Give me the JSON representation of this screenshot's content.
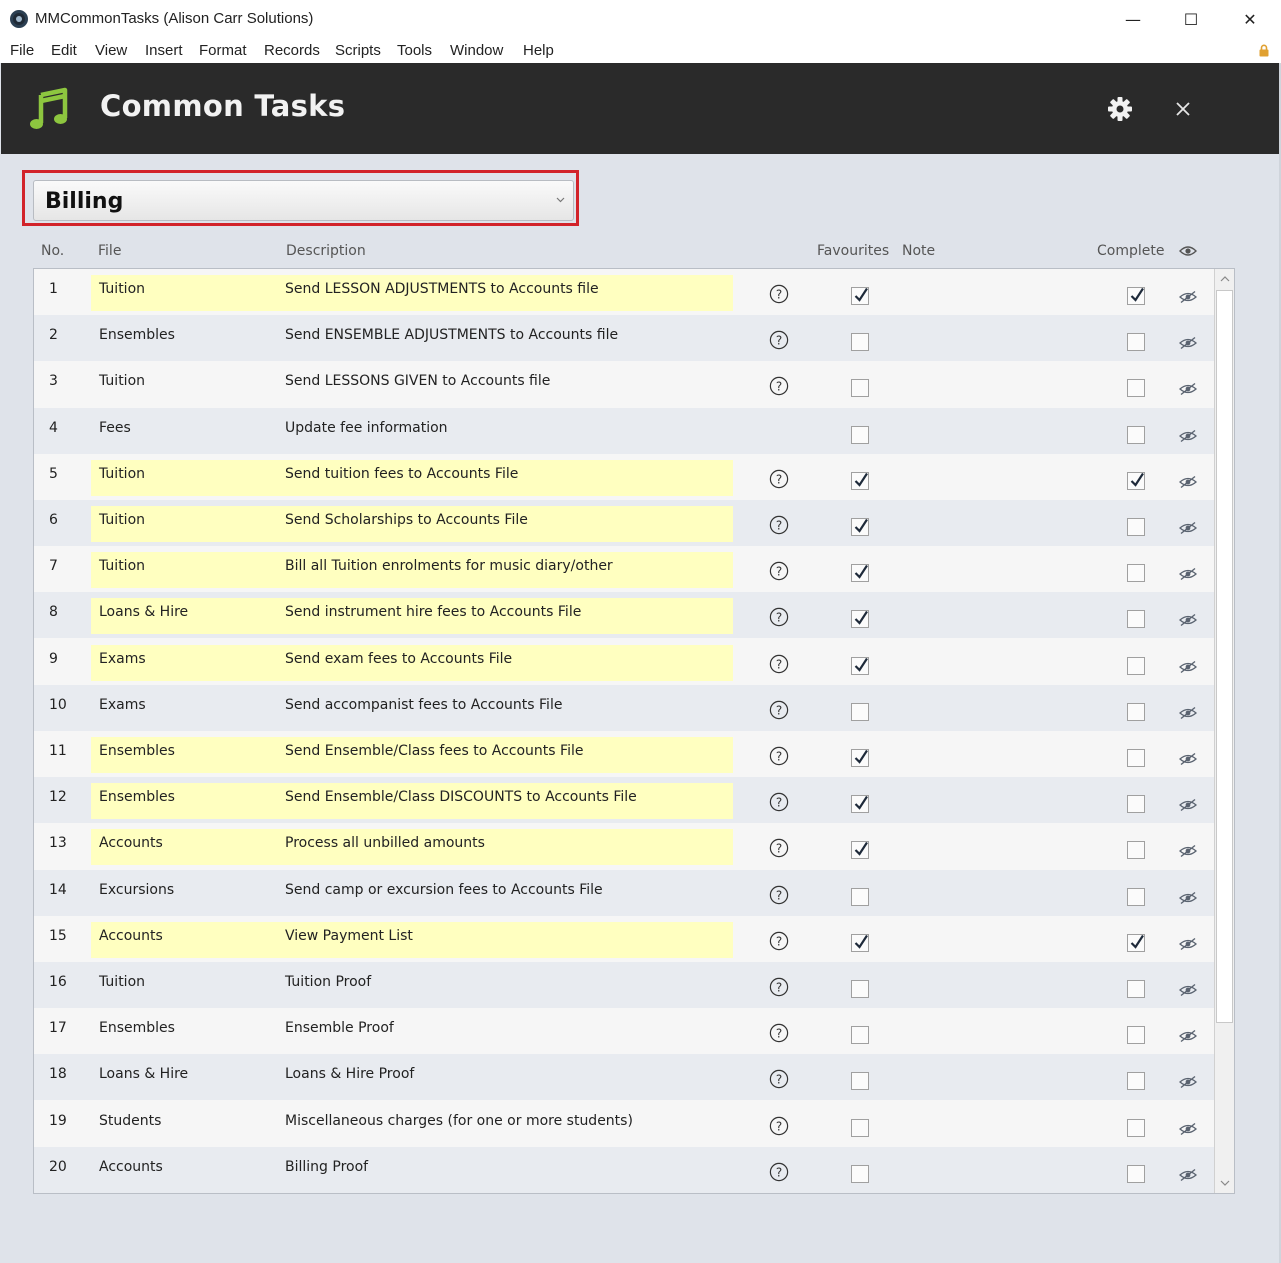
{
  "window": {
    "title": "MMCommonTasks (Alison Carr Solutions)",
    "minimize": "—",
    "maximize": "☐",
    "close": "✕"
  },
  "menu": [
    "File",
    "Edit",
    "View",
    "Insert",
    "Format",
    "Records",
    "Scripts",
    "Tools",
    "Window",
    "Help"
  ],
  "header": {
    "title": "Common Tasks",
    "accent_color": "#8dc63f",
    "background": "#2a2a2a"
  },
  "category_dropdown": {
    "selected": "Billing"
  },
  "columns": {
    "no": "No.",
    "file": "File",
    "description": "Description",
    "favourites": "Favourites",
    "note": "Note",
    "complete": "Complete"
  },
  "colors": {
    "highlight": "#ffffc0",
    "row_alt": "#e8ebf0",
    "selection_border": "#d2232a"
  },
  "rows": [
    {
      "no": "1",
      "file": "Tuition",
      "description": "Send LESSON ADJUSTMENTS to Accounts file",
      "help": true,
      "favourite": true,
      "complete": true,
      "highlight": true
    },
    {
      "no": "2",
      "file": "Ensembles",
      "description": "Send ENSEMBLE ADJUSTMENTS to Accounts file",
      "help": true,
      "favourite": false,
      "complete": false,
      "highlight": false
    },
    {
      "no": "3",
      "file": "Tuition",
      "description": "Send LESSONS GIVEN to Accounts file",
      "help": true,
      "favourite": false,
      "complete": false,
      "highlight": false
    },
    {
      "no": "4",
      "file": "Fees",
      "description": "Update fee information",
      "help": false,
      "favourite": false,
      "complete": false,
      "highlight": false
    },
    {
      "no": "5",
      "file": "Tuition",
      "description": "Send tuition fees to Accounts File",
      "help": true,
      "favourite": true,
      "complete": true,
      "highlight": true
    },
    {
      "no": "6",
      "file": "Tuition",
      "description": "Send Scholarships to Accounts File",
      "help": true,
      "favourite": true,
      "complete": false,
      "highlight": true
    },
    {
      "no": "7",
      "file": "Tuition",
      "description": "Bill all Tuition enrolments for music diary/other",
      "help": true,
      "favourite": true,
      "complete": false,
      "highlight": true
    },
    {
      "no": "8",
      "file": "Loans & Hire",
      "description": "Send instrument hire fees to Accounts File",
      "help": true,
      "favourite": true,
      "complete": false,
      "highlight": true
    },
    {
      "no": "9",
      "file": "Exams",
      "description": "Send exam fees to Accounts File",
      "help": true,
      "favourite": true,
      "complete": false,
      "highlight": true
    },
    {
      "no": "10",
      "file": "Exams",
      "description": "Send accompanist fees to Accounts File",
      "help": true,
      "favourite": false,
      "complete": false,
      "highlight": false
    },
    {
      "no": "11",
      "file": "Ensembles",
      "description": "Send Ensemble/Class fees to Accounts File",
      "help": true,
      "favourite": true,
      "complete": false,
      "highlight": true
    },
    {
      "no": "12",
      "file": "Ensembles",
      "description": "Send Ensemble/Class DISCOUNTS to Accounts File",
      "help": true,
      "favourite": true,
      "complete": false,
      "highlight": true
    },
    {
      "no": "13",
      "file": "Accounts",
      "description": "Process all unbilled amounts",
      "help": true,
      "favourite": true,
      "complete": false,
      "highlight": true
    },
    {
      "no": "14",
      "file": "Excursions",
      "description": "Send camp or excursion fees to Accounts File",
      "help": true,
      "favourite": false,
      "complete": false,
      "highlight": false
    },
    {
      "no": "15",
      "file": "Accounts",
      "description": "View Payment List",
      "help": true,
      "favourite": true,
      "complete": true,
      "highlight": true
    },
    {
      "no": "16",
      "file": "Tuition",
      "description": "Tuition Proof",
      "help": true,
      "favourite": false,
      "complete": false,
      "highlight": false
    },
    {
      "no": "17",
      "file": "Ensembles",
      "description": "Ensemble Proof",
      "help": true,
      "favourite": false,
      "complete": false,
      "highlight": false
    },
    {
      "no": "18",
      "file": "Loans & Hire",
      "description": "Loans & Hire Proof",
      "help": true,
      "favourite": false,
      "complete": false,
      "highlight": false
    },
    {
      "no": "19",
      "file": "Students",
      "description": "Miscellaneous charges (for one or more students)",
      "help": true,
      "favourite": false,
      "complete": false,
      "highlight": false
    },
    {
      "no": "20",
      "file": "Accounts",
      "description": "Billing Proof",
      "help": true,
      "favourite": false,
      "complete": false,
      "highlight": false
    }
  ]
}
